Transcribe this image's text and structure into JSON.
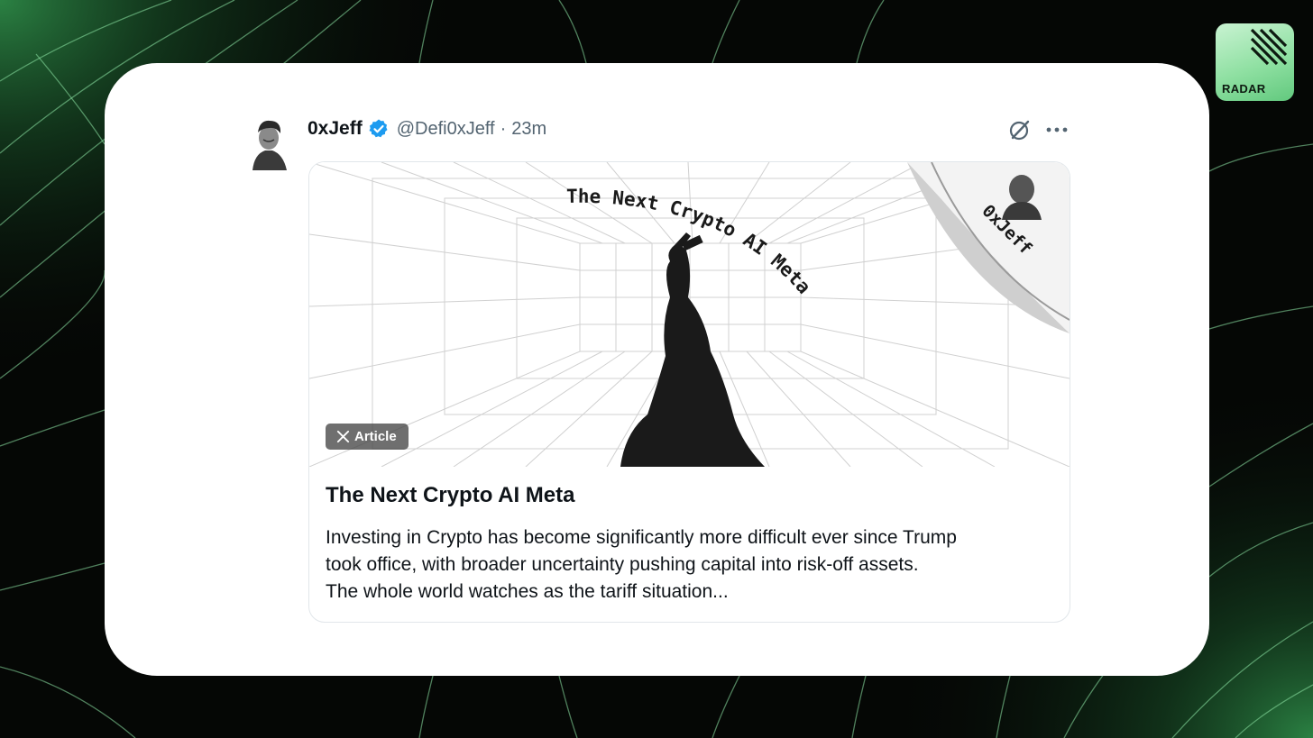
{
  "brand": {
    "label": "RADAR"
  },
  "post": {
    "author_name": "0xJeff",
    "handle": "@Defi0xJeff",
    "separator": "·",
    "time": "23m",
    "icons": {
      "verified": "verified-badge-icon",
      "grok": "grok-icon",
      "more": "more-icon"
    }
  },
  "article": {
    "badge_label": "Article",
    "image": {
      "arc_text": "The Next Crypto AI Meta",
      "sticker_text": "0xJeff"
    },
    "title": "The Next Crypto AI Meta",
    "desc_line1": "Investing in Crypto has become significantly more difficult ever since Trump",
    "desc_line2": "took office, with broader uncertainty pushing capital into risk-off assets.",
    "desc_line3": "The whole world watches as the tariff situation..."
  },
  "colors": {
    "background": "#050705",
    "accent_green": "#6fdc8c",
    "verified_blue": "#1d9bf0",
    "card": "#ffffff"
  }
}
